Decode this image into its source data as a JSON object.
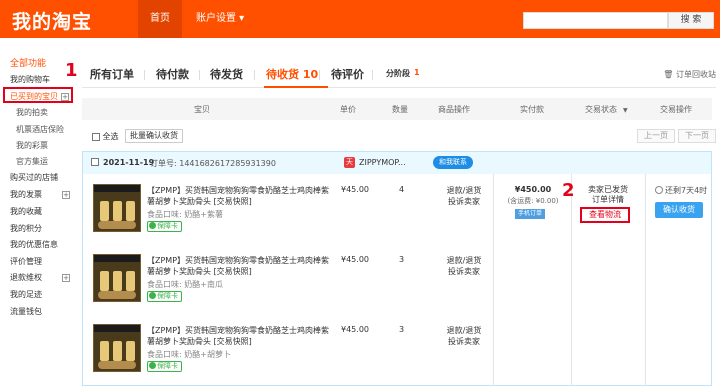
{
  "header": {
    "logo": "我的淘宝",
    "nav": [
      {
        "label": "首页"
      },
      {
        "label": "账户设置 ▾"
      }
    ],
    "search_button": "搜 索"
  },
  "sidebar": {
    "title": "全部功能",
    "items": [
      {
        "label": "我的购物车"
      },
      {
        "label": "已买到的宝贝"
      },
      {
        "label": "我的拍卖"
      },
      {
        "label": "机票酒店保险"
      },
      {
        "label": "我的彩票"
      },
      {
        "label": "官方集运"
      },
      {
        "label": "购买过的店铺"
      },
      {
        "label": "我的发票"
      },
      {
        "label": "我的收藏"
      },
      {
        "label": "我的积分"
      },
      {
        "label": "我的优惠信息"
      },
      {
        "label": "评价管理"
      },
      {
        "label": "退款维权"
      },
      {
        "label": "我的足迹"
      },
      {
        "label": "流量钱包"
      }
    ],
    "toggle": "+",
    "annotation_number": "1"
  },
  "tabs": [
    {
      "label": "所有订单"
    },
    {
      "label": "待付款"
    },
    {
      "label": "待发货"
    },
    {
      "label": "待收货 10"
    },
    {
      "label": "待评价"
    },
    {
      "label": "分阶段"
    },
    {
      "label": "1"
    }
  ],
  "recycle_label": "🗑 订单回收站",
  "table_headers": [
    "宝贝",
    "单价",
    "数量",
    "商品操作",
    "实付款",
    "交易状态",
    "交易操作"
  ],
  "sort_glyph": "▼",
  "batch": {
    "select_all": "全选",
    "confirm_button": "批量确认收货",
    "prev": "上一页",
    "next": "下一页"
  },
  "order": {
    "date": "2021-11-19",
    "order_no": "订单号: 1441682617285931390",
    "shop_icon": "天",
    "shop": "ZIPPYMOP...",
    "contact": "和我联系",
    "items": [
      {
        "title": "【ZPMP】买货韩国宠物狗狗零食奶酪芝士鸡肉棒紫薯胡萝卜奖励骨头 [交易快照]",
        "attr": "食品口味: 奶酪+紫薯",
        "insure": "保障卡",
        "price": "¥45.00",
        "qty": "4",
        "ops": [
          "退款/退货",
          "投诉卖家"
        ]
      },
      {
        "title": "【ZPMP】买货韩国宠物狗狗零食奶酪芝士鸡肉棒紫薯胡萝卜奖励骨头 [交易快照]",
        "attr": "食品口味: 奶酪+南瓜",
        "insure": "保障卡",
        "price": "¥45.00",
        "qty": "3",
        "ops": [
          "退款/退货",
          "投诉卖家"
        ]
      },
      {
        "title": "【ZPMP】买货韩国宠物狗狗零食奶酪芝士鸡肉棒紫薯胡萝卜奖励骨头 [交易快照]",
        "attr": "食品口味: 奶酪+胡萝卜",
        "insure": "保障卡",
        "price": "¥45.00",
        "qty": "3",
        "ops": [
          "退款/退货",
          "投诉卖家"
        ]
      }
    ],
    "total": "¥450.00",
    "shipping": "(含运费: ¥0.00)",
    "pay_badge": "手机订单",
    "status": [
      "卖家已发货",
      "订单详情"
    ],
    "logistics": "查看物流",
    "remaining": "还剩7天4时",
    "confirm": "确认收货",
    "annotation_number": "2"
  },
  "colors": {
    "brand": "#ff5000",
    "annotation": "#e3001b",
    "accent": "#3aa3f0"
  }
}
